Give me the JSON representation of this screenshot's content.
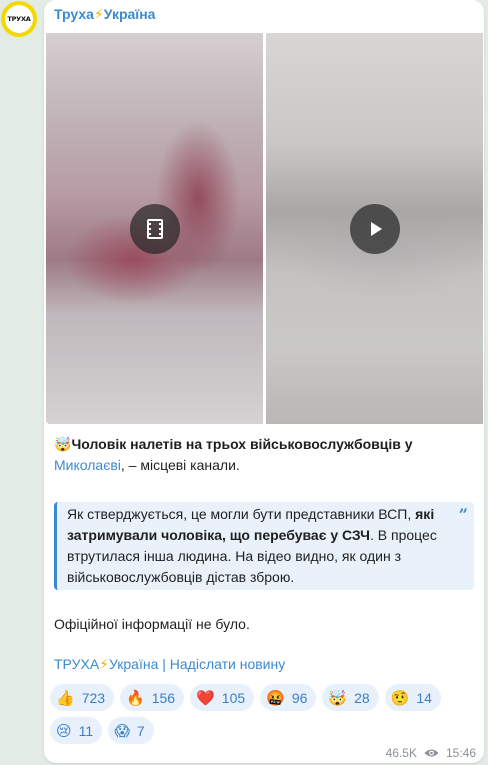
{
  "channel": {
    "name_part1": "Труха",
    "name_bolt": "⚡",
    "name_part2": "Україна",
    "avatar_text": "ТРУХА"
  },
  "media": [
    {
      "type": "video",
      "icon": "film-icon"
    },
    {
      "type": "video",
      "icon": "play-icon"
    }
  ],
  "post": {
    "p1_emoji": "🤯",
    "p1_bold": "Чоловік налетів на трьох військовослужбовців у ",
    "p1_link": "Миколаєві",
    "p1_rest": ", – місцеві канали.",
    "quote_part1": "Як стверджується, це могли бути представники ВСП, ",
    "quote_bold": "які затримували чоловіка, що перебуває у СЗЧ",
    "quote_part2": ". В процес втрутилася інша людина. На відео видно, як один з військовослужбовців дістав зброю.",
    "quote_mark": "”",
    "p2": "Офіційної інформації не було.",
    "footer_link_part1": "ТРУХА",
    "footer_bolt": "⚡",
    "footer_link_part2": "Україна | Надіслати новину"
  },
  "reactions": [
    {
      "emoji": "👍",
      "count": "723"
    },
    {
      "emoji": "🔥",
      "count": "156"
    },
    {
      "emoji": "❤️",
      "count": "105"
    },
    {
      "emoji": "🤬",
      "count": "96"
    },
    {
      "emoji": "🤯",
      "count": "28"
    },
    {
      "emoji": "🤨",
      "count": "14"
    },
    {
      "emoji": "😢",
      "count": "11"
    },
    {
      "emoji": "😱",
      "count": "7"
    }
  ],
  "meta": {
    "views": "46.5K",
    "time": "15:46"
  },
  "colors": {
    "accent": "#3a8ad0",
    "chat_background": "#e3ece4",
    "reaction_background": "#e8f1fb"
  }
}
